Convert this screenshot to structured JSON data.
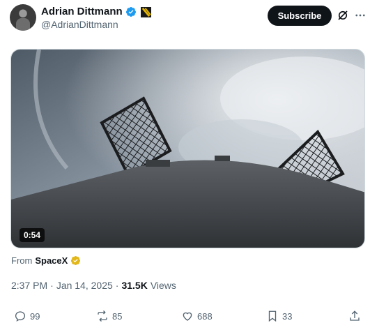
{
  "author": {
    "name": "Adrian Dittmann",
    "handle": "@AdrianDittmann"
  },
  "header": {
    "subscribe_label": "Subscribe"
  },
  "media": {
    "duration": "0:54"
  },
  "source": {
    "from_label": "From",
    "name": "SpaceX"
  },
  "meta": {
    "time": "2:37 PM",
    "separator": "·",
    "date": "Jan 14, 2025",
    "views_count": "31.5K",
    "views_label": "Views"
  },
  "actions": {
    "replies": "99",
    "reposts": "85",
    "likes": "688",
    "bookmarks": "33"
  },
  "colors": {
    "verified_blue": "#1d9bf0",
    "gold_badge": "#e2b719",
    "subscribe_bg": "#0f1419",
    "secondary_text": "#536471"
  },
  "icons": [
    "verified-icon",
    "flag-icon",
    "grok-icon",
    "more-icon",
    "reply-icon",
    "repost-icon",
    "like-icon",
    "bookmark-icon",
    "share-icon"
  ]
}
